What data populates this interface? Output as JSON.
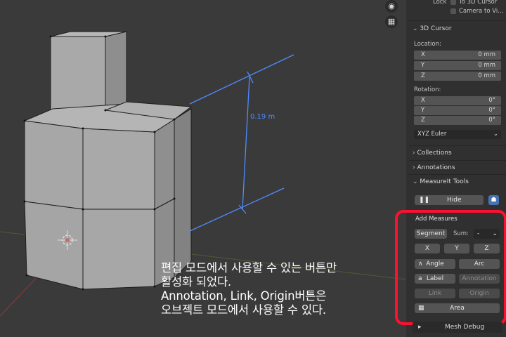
{
  "viewport": {
    "measure_label": "0.19 m",
    "caption": [
      "편집 모드에서 사용할 수 있는 버튼만",
      "활성화 되었다.",
      "Annotation, Link, Origin버튼은",
      "오브젝트 모드에서 사용할 수 있다."
    ],
    "tools": {
      "camera_icon": "camera-icon",
      "grid_icon": "perspective-grid-icon"
    }
  },
  "sidebar": {
    "lock_label": "Lock",
    "to_cursor": "To 3D Cursor",
    "camera_to_view": "Camera to Vi...",
    "cursor_panel": {
      "title": "3D Cursor",
      "location_label": "Location:",
      "location": [
        {
          "axis": "X",
          "value": "0 mm"
        },
        {
          "axis": "Y",
          "value": "0 mm"
        },
        {
          "axis": "Z",
          "value": "0 mm"
        }
      ],
      "rotation_label": "Rotation:",
      "rotation": [
        {
          "axis": "X",
          "value": "0°"
        },
        {
          "axis": "Y",
          "value": "0°"
        },
        {
          "axis": "Z",
          "value": "0°"
        }
      ],
      "rotation_mode": "XYZ Euler"
    },
    "collections": "Collections",
    "annotations": "Annotations",
    "measureit": {
      "title": "MeasureIt Tools",
      "hide": "Hide",
      "add_measures": "Add Measures",
      "segment": "Segment",
      "sum_label": "Sum:",
      "sum_value": "-",
      "x": "X",
      "y": "Y",
      "z": "Z",
      "angle": "Angle",
      "arc": "Arc",
      "label": "Label",
      "annotation": "Annotation",
      "link": "Link",
      "origin": "Origin",
      "area": "Area"
    },
    "mesh_debug": "Mesh Debug"
  },
  "colors": {
    "accent_blue": "#4772b3",
    "highlight_red": "#ff1030",
    "measure_blue": "#4f8bff"
  }
}
